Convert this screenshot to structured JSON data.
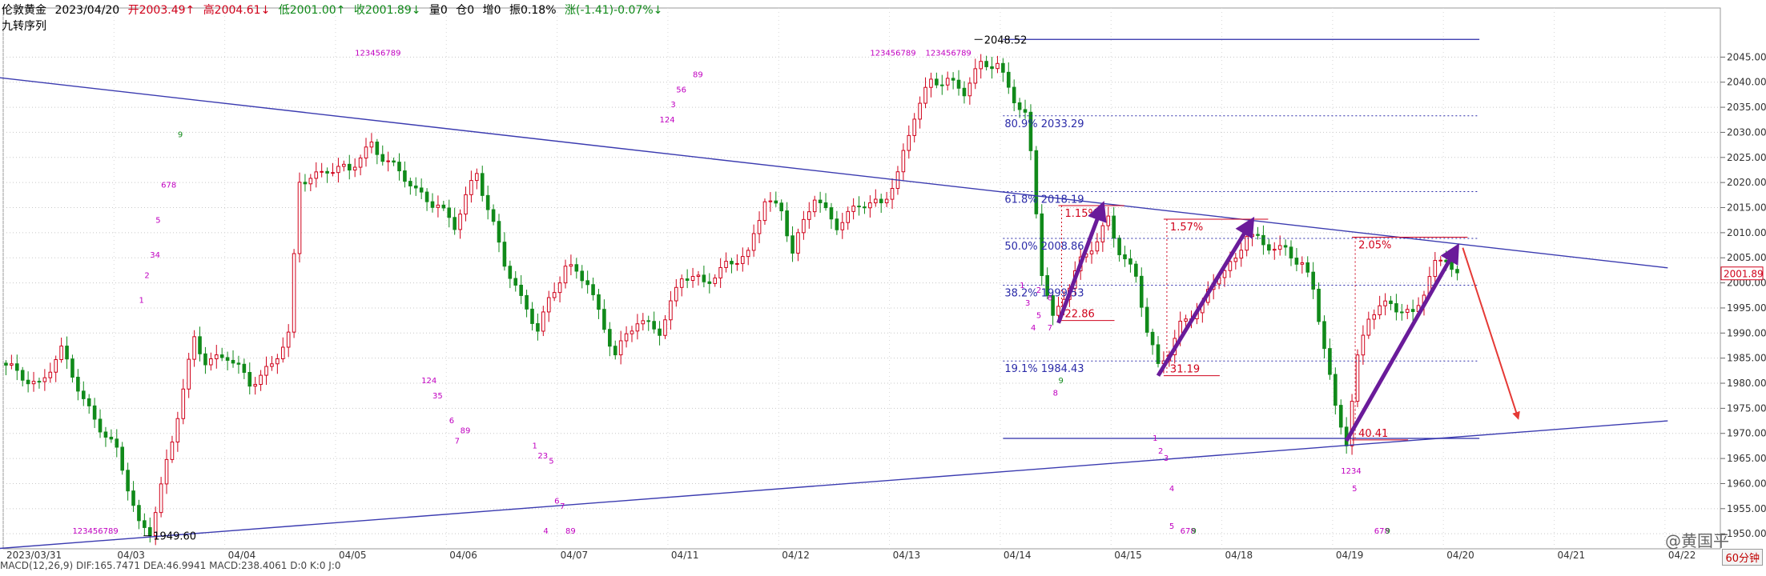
{
  "header": {
    "instrument": "伦敦黄金",
    "date": "2023/04/20",
    "open": "开2003.49↑",
    "high": "高2004.61↓",
    "low": "低2001.00↑",
    "close": "收2001.89↓",
    "volume": "量0",
    "position": "仓0",
    "increase": "增0",
    "amplitude": "振0.18%",
    "change": "涨(-1.41)-0.07%↓",
    "indicator_label": "九转序列"
  },
  "timeframe_label": "60分钟",
  "watermark_text": "@黄国平",
  "bottom_indicator_text": "MACD(12,26,9)  DIF:165.7471  DEA:46.9941  MACD:238.4061  D:0  K:0  J:0",
  "colors": {
    "up": "#d0021b",
    "down": "#118a1a",
    "trendline": "#3b3bb0",
    "fib": "#2a2aa8",
    "arrow": "#6a1b9a",
    "red_arrow": "#e53935",
    "magenta": "#c000c0",
    "grid": "#c8c8c8"
  },
  "chart_data": {
    "type": "candlestick",
    "y_range": [
      1947,
      2050
    ],
    "y_ticks": [
      "2045.00",
      "2040.00",
      "2035.00",
      "2030.00",
      "2025.00",
      "2020.00",
      "2015.00",
      "2010.00",
      "2005.00",
      "2000.00",
      "1995.00",
      "1990.00",
      "1985.00",
      "1980.00",
      "1975.00",
      "1970.00",
      "1965.00",
      "1960.00",
      "1955.00",
      "1950.00"
    ],
    "last_price": "2001.89",
    "date_labels": [
      {
        "label": "2023/03/31",
        "i": 0
      },
      {
        "label": "04/03",
        "i": 20
      },
      {
        "label": "04/04",
        "i": 40
      },
      {
        "label": "04/05",
        "i": 60
      },
      {
        "label": "04/06",
        "i": 80
      },
      {
        "label": "04/07",
        "i": 100
      },
      {
        "label": "04/11",
        "i": 120
      },
      {
        "label": "04/12",
        "i": 140
      },
      {
        "label": "04/13",
        "i": 160
      },
      {
        "label": "04/14",
        "i": 180
      },
      {
        "label": "04/15",
        "i": 200
      },
      {
        "label": "04/18",
        "i": 220
      },
      {
        "label": "04/19",
        "i": 240
      },
      {
        "label": "04/20",
        "i": 260
      },
      {
        "label": "04/21",
        "i": 280
      },
      {
        "label": "04/22",
        "i": 300
      }
    ],
    "n_slots": 310,
    "anchors": [
      [
        0,
        1983
      ],
      [
        6,
        1980
      ],
      [
        10,
        1986
      ],
      [
        14,
        1977
      ],
      [
        20,
        1966
      ],
      [
        24,
        1952
      ],
      [
        26,
        1951
      ],
      [
        30,
        1968
      ],
      [
        34,
        1989
      ],
      [
        36,
        1985
      ],
      [
        40,
        1985
      ],
      [
        44,
        1980
      ],
      [
        48,
        1984
      ],
      [
        51,
        1989
      ],
      [
        53,
        2020
      ],
      [
        58,
        2023
      ],
      [
        62,
        2022
      ],
      [
        66,
        2028
      ],
      [
        70,
        2023
      ],
      [
        74,
        2018
      ],
      [
        78,
        2016
      ],
      [
        81,
        2011
      ],
      [
        85,
        2022
      ],
      [
        88,
        2012
      ],
      [
        90,
        2004
      ],
      [
        93,
        1996
      ],
      [
        96,
        1991
      ],
      [
        98,
        1997
      ],
      [
        101,
        2003
      ],
      [
        105,
        2000
      ],
      [
        110,
        1986
      ],
      [
        114,
        1992
      ],
      [
        118,
        1991
      ],
      [
        122,
        2001
      ],
      [
        126,
        2000
      ],
      [
        130,
        2004
      ],
      [
        134,
        2005
      ],
      [
        137,
        2017
      ],
      [
        140,
        2015
      ],
      [
        142,
        2006
      ],
      [
        146,
        2017
      ],
      [
        150,
        2012
      ],
      [
        154,
        2015
      ],
      [
        158,
        2016
      ],
      [
        161,
        2022
      ],
      [
        164,
        2033
      ],
      [
        167,
        2040
      ],
      [
        170,
        2041
      ],
      [
        173,
        2038
      ],
      [
        176,
        2043
      ],
      [
        179,
        2044
      ],
      [
        182,
        2037
      ],
      [
        184,
        2033
      ],
      [
        185,
        2025
      ],
      [
        187,
        2002
      ],
      [
        189,
        1993
      ],
      [
        191,
        1998
      ],
      [
        194,
        2004
      ],
      [
        197,
        2008
      ],
      [
        199,
        2013
      ],
      [
        201,
        2007
      ],
      [
        204,
        2001
      ],
      [
        206,
        1990
      ],
      [
        208,
        1983
      ],
      [
        210,
        1987
      ],
      [
        212,
        1992
      ],
      [
        216,
        1995
      ],
      [
        219,
        2002
      ],
      [
        222,
        2005
      ],
      [
        224,
        2010
      ],
      [
        227,
        2007
      ],
      [
        231,
        2007
      ],
      [
        234,
        2004
      ],
      [
        236,
        1998
      ],
      [
        238,
        1987
      ],
      [
        240,
        1975
      ],
      [
        242,
        1969
      ],
      [
        244,
        1985
      ],
      [
        246,
        1993
      ],
      [
        250,
        1996
      ],
      [
        254,
        1994
      ],
      [
        256,
        1998
      ],
      [
        258,
        2003
      ],
      [
        260,
        2005
      ],
      [
        262,
        2002
      ]
    ],
    "key_points": [
      {
        "text": "2048.52",
        "i": 176,
        "v": 2048.52
      },
      {
        "text": "1949.60",
        "i": 26,
        "v": 1949.6
      }
    ],
    "fib_levels": [
      {
        "label": "80.9% 2033.29",
        "v": 2033.29
      },
      {
        "label": "61.8% 2018.19",
        "v": 2018.19
      },
      {
        "label": "50.0% 2008.86",
        "v": 2008.86
      },
      {
        "label": "38.2% 1999.53",
        "v": 1999.53
      },
      {
        "label": "19.1% 1984.43",
        "v": 1984.43
      }
    ],
    "fib_top": 2048.52,
    "fib_bottom": 1969.0,
    "measurements": [
      {
        "pct": "1.15%",
        "amt": "22.86",
        "i0": 190,
        "i1": 201,
        "v_low": 1992.5,
        "v_high": 2015.4
      },
      {
        "pct": "1.57%",
        "amt": "31.19",
        "i0": 209,
        "i1": 227,
        "v_low": 1981.5,
        "v_high": 2012.7
      },
      {
        "pct": "2.05%",
        "amt": "40.41",
        "i0": 243,
        "i1": 263,
        "v_low": 1968.7,
        "v_high": 2009.1
      }
    ],
    "trendlines": [
      {
        "i0": -2,
        "v0": 2041,
        "i1": 300,
        "v1": 2003
      },
      {
        "i0": -2,
        "v0": 1947,
        "i1": 300,
        "v1": 1972.5
      }
    ],
    "purple_arrows": [
      {
        "i0": 190,
        "v0": 1992,
        "i1": 198,
        "v1": 2015.6
      },
      {
        "i0": 208,
        "v0": 1981.5,
        "i1": 225,
        "v1": 2012.5
      },
      {
        "i0": 242,
        "v0": 1968.5,
        "i1": 262,
        "v1": 2007.2
      }
    ],
    "red_arrow": {
      "i0": 263,
      "v0": 2007,
      "i1": 273,
      "v1": 1973
    },
    "td_labels": [
      {
        "t": "123456789",
        "i": 63,
        "v": 2045.3
      },
      {
        "t": "123456789",
        "i": 156,
        "v": 2045.3
      },
      {
        "t": "123456789",
        "i": 166,
        "v": 2045.3
      },
      {
        "t": "9",
        "i": 31,
        "v": 2029
      },
      {
        "t": "678",
        "i": 28,
        "v": 2019
      },
      {
        "t": "5",
        "i": 27,
        "v": 2012
      },
      {
        "t": "34",
        "i": 26,
        "v": 2005
      },
      {
        "t": "2",
        "i": 25,
        "v": 2001
      },
      {
        "t": "1",
        "i": 24,
        "v": 1996
      },
      {
        "t": "89",
        "i": 124,
        "v": 2041
      },
      {
        "t": "56",
        "i": 121,
        "v": 2038
      },
      {
        "t": "3",
        "i": 120,
        "v": 2035
      },
      {
        "t": "124",
        "i": 118,
        "v": 2032
      },
      {
        "t": "124",
        "i": 75,
        "v": 1980
      },
      {
        "t": "35",
        "i": 77,
        "v": 1977
      },
      {
        "t": "6",
        "i": 80,
        "v": 1972
      },
      {
        "t": "89",
        "i": 82,
        "v": 1970
      },
      {
        "t": "7",
        "i": 81,
        "v": 1968
      },
      {
        "t": "1",
        "i": 95,
        "v": 1967
      },
      {
        "t": "23",
        "i": 96,
        "v": 1965
      },
      {
        "t": "5",
        "i": 98,
        "v": 1964
      },
      {
        "t": "6",
        "i": 99,
        "v": 1956
      },
      {
        "t": "7",
        "i": 100,
        "v": 1955
      },
      {
        "t": "4",
        "i": 97,
        "v": 1950
      },
      {
        "t": "89",
        "i": 101,
        "v": 1950
      },
      {
        "t": "123456789",
        "i": 12,
        "v": 1950
      },
      {
        "t": "1",
        "i": 183,
        "v": 1999
      },
      {
        "t": "2",
        "i": 186,
        "v": 1998
      },
      {
        "t": "6",
        "i": 188,
        "v": 1996.5
      },
      {
        "t": "3",
        "i": 184,
        "v": 1995.5
      },
      {
        "t": "5",
        "i": 186,
        "v": 1993
      },
      {
        "t": "4",
        "i": 185,
        "v": 1990.5
      },
      {
        "t": "7",
        "i": 188,
        "v": 1990.5
      },
      {
        "t": "9",
        "i": 190,
        "v": 1980
      },
      {
        "t": "8",
        "i": 189,
        "v": 1977.5
      },
      {
        "t": "1",
        "i": 207,
        "v": 1968.5
      },
      {
        "t": "2",
        "i": 208,
        "v": 1966
      },
      {
        "t": "3",
        "i": 209,
        "v": 1964.5
      },
      {
        "t": "4",
        "i": 210,
        "v": 1958.5
      },
      {
        "t": "5",
        "i": 210,
        "v": 1951
      },
      {
        "t": "678",
        "i": 212,
        "v": 1950
      },
      {
        "t": "9",
        "i": 214,
        "v": 1950
      },
      {
        "t": "1234",
        "i": 241,
        "v": 1962
      },
      {
        "t": "5",
        "i": 243,
        "v": 1958.5
      },
      {
        "t": "678",
        "i": 247,
        "v": 1950
      },
      {
        "t": "9",
        "i": 249,
        "v": 1950
      }
    ]
  }
}
